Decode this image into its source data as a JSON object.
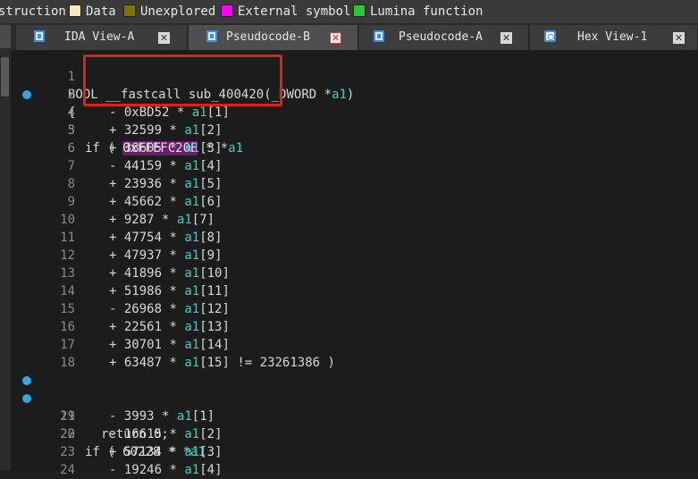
{
  "legend": [
    {
      "label": "struction",
      "color": ""
    },
    {
      "label": "Data",
      "color": "#f4e9b8"
    },
    {
      "label": "Unexplored",
      "color": "#7a7400"
    },
    {
      "label": "External symbol",
      "color": "#ff00ff"
    },
    {
      "label": "Lumina function",
      "color": "#30c830"
    }
  ],
  "tabs": [
    {
      "label": "IDA View-A",
      "icon": "ida-view-icon",
      "active": false
    },
    {
      "label": "Pseudocode-B",
      "icon": "pseudocode-icon",
      "active": true
    },
    {
      "label": "Pseudocode-A",
      "icon": "pseudocode-icon",
      "active": false
    },
    {
      "label": "Hex View-1",
      "icon": "hex-view-icon",
      "active": false
    }
  ],
  "code": {
    "header": {
      "type": "BOOL",
      "conv": "__fastcall",
      "name": "sub_400420",
      "paren": "(_DWORD *",
      "arg": "a1",
      "close": ")"
    },
    "open_brace": "{",
    "first_if": {
      "prefix": "if ( ",
      "hex": "0xFFFFC20E",
      "mid": " * *",
      "var": "a1"
    },
    "first_terms": [
      {
        "op": "-",
        "coef": "0xBD52",
        "idx": "1"
      },
      {
        "op": "+",
        "coef": "32599",
        "idx": "2"
      },
      {
        "op": "+",
        "coef": "38605",
        "idx": "3"
      },
      {
        "op": "-",
        "coef": "44159",
        "idx": "4"
      },
      {
        "op": "+",
        "coef": "23936",
        "idx": "5"
      },
      {
        "op": "+",
        "coef": "45662",
        "idx": "6"
      },
      {
        "op": "+",
        "coef": "9287",
        "idx": "7"
      },
      {
        "op": "+",
        "coef": "47754",
        "idx": "8"
      },
      {
        "op": "+",
        "coef": "47937",
        "idx": "9"
      },
      {
        "op": "+",
        "coef": "41896",
        "idx": "10"
      },
      {
        "op": "+",
        "coef": "51986",
        "idx": "11"
      },
      {
        "op": "-",
        "coef": "26968",
        "idx": "12"
      },
      {
        "op": "+",
        "coef": "22561",
        "idx": "13"
      },
      {
        "op": "+",
        "coef": "30701",
        "idx": "14"
      },
      {
        "op": "+",
        "coef": "63487",
        "idx": "15",
        "tail": " != 23261386 )"
      }
    ],
    "return_stmt": "return 0;",
    "second_if": {
      "prefix": "if ( ",
      "coef": "60228",
      "mid": " * *",
      "var": "a1"
    },
    "second_terms": [
      {
        "op": "-",
        "coef": "3993",
        "idx": "1"
      },
      {
        "op": "-",
        "coef": "16615",
        "idx": "2"
      },
      {
        "op": "+",
        "coef": "57134",
        "idx": "3"
      },
      {
        "op": "-",
        "coef": "19246",
        "idx": "4"
      }
    ],
    "breakpoint_lines": [
      3,
      19,
      20
    ]
  }
}
